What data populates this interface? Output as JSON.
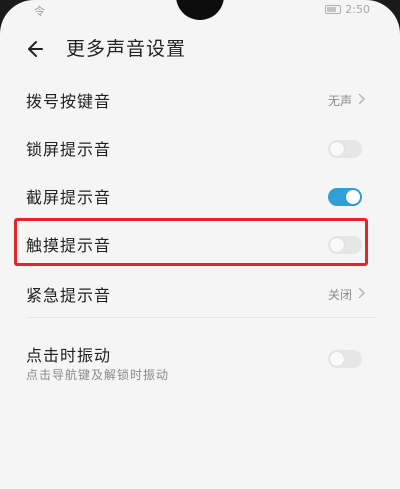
{
  "status": {
    "left": "令",
    "right": "2:50"
  },
  "header": {
    "title": "更多声音设置"
  },
  "rows": [
    {
      "label": "拨号按键音",
      "value": "无声"
    },
    {
      "label": "锁屏提示音",
      "toggle": "off"
    },
    {
      "label": "截屏提示音",
      "toggle": "on"
    },
    {
      "label": "触摸提示音",
      "toggle": "off"
    },
    {
      "label": "紧急提示音",
      "value": "关闭"
    },
    {
      "label": "点击时振动",
      "sub": "点击导航键及解锁时振动",
      "toggle": "off"
    }
  ],
  "colors": {
    "accent": "#2fa0d6",
    "highlight": "#e2262a"
  },
  "icons": [
    "back-arrow-icon",
    "chevron-right-icon"
  ]
}
